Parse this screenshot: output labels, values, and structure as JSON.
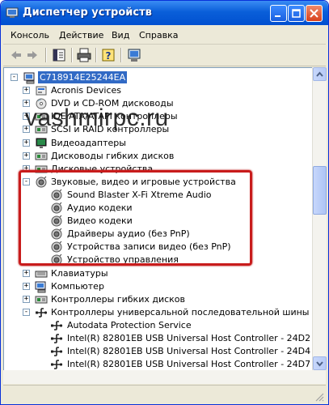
{
  "window": {
    "title": "Диспетчер устройств",
    "controls": {
      "minimize": "minimize-button",
      "maximize": "maximize-button",
      "close": "close-button"
    }
  },
  "menu": [
    "Консоль",
    "Действие",
    "Вид",
    "Справка"
  ],
  "toolbar": {
    "buttons": [
      "back-arrow-icon",
      "forward-arrow-icon",
      "properties-icon",
      "print-icon",
      "help-icon",
      "scan-hardware-icon"
    ]
  },
  "watermark": "vashmirpc.ru",
  "tree": {
    "root": "C718914E25244EA",
    "nodes": [
      {
        "label": "Acronis Devices",
        "icon": "acronis-icon",
        "expander": "+"
      },
      {
        "label": "DVD и CD-ROM дисководы",
        "icon": "dvd-drive-icon",
        "expander": "+"
      },
      {
        "label": "IDE ATA/ATAPI контроллеры",
        "icon": "ide-controller-icon",
        "expander": "+"
      },
      {
        "label": "SCSI и RAID контроллеры",
        "icon": "scsi-controller-icon",
        "expander": "+"
      },
      {
        "label": "Видеоадаптеры",
        "icon": "display-adapter-icon",
        "expander": "+"
      },
      {
        "label": "Дисководы гибких дисков",
        "icon": "floppy-drive-icon",
        "expander": "+"
      },
      {
        "label": "Дисковые устройства",
        "icon": "disk-drive-icon",
        "expander": "+"
      },
      {
        "label": "Звуковые, видео и игровые устройства",
        "icon": "sound-device-icon",
        "expander": "-",
        "children": [
          "Sound Blaster X-Fi Xtreme Audio",
          "Аудио кодеки",
          "Видео кодеки",
          "Драйверы аудио (без PnP)",
          "Устройства записи видео (без PnP)",
          "Устройство управления"
        ]
      },
      {
        "label": "Клавиатуры",
        "icon": "keyboard-icon",
        "expander": "+"
      },
      {
        "label": "Компьютер",
        "icon": "computer-icon",
        "expander": "+"
      },
      {
        "label": "Контроллеры гибких дисков",
        "icon": "floppy-controller-icon",
        "expander": "+"
      },
      {
        "label": "Контроллеры универсальной последовательной шины USB",
        "icon": "usb-controller-icon",
        "expander": "-",
        "children": [
          "Autodata Protection Service",
          "Intel(R) 82801EB USB Universal Host Controller - 24D2",
          "Intel(R) 82801EB USB Universal Host Controller - 24D4",
          "Intel(R) 82801EB USB Universal Host Controller - 24D7"
        ]
      }
    ]
  },
  "colors": {
    "titlebar": "#0a5fd9",
    "selection": "#316ac5",
    "highlight_frame": "#c81c1c"
  }
}
